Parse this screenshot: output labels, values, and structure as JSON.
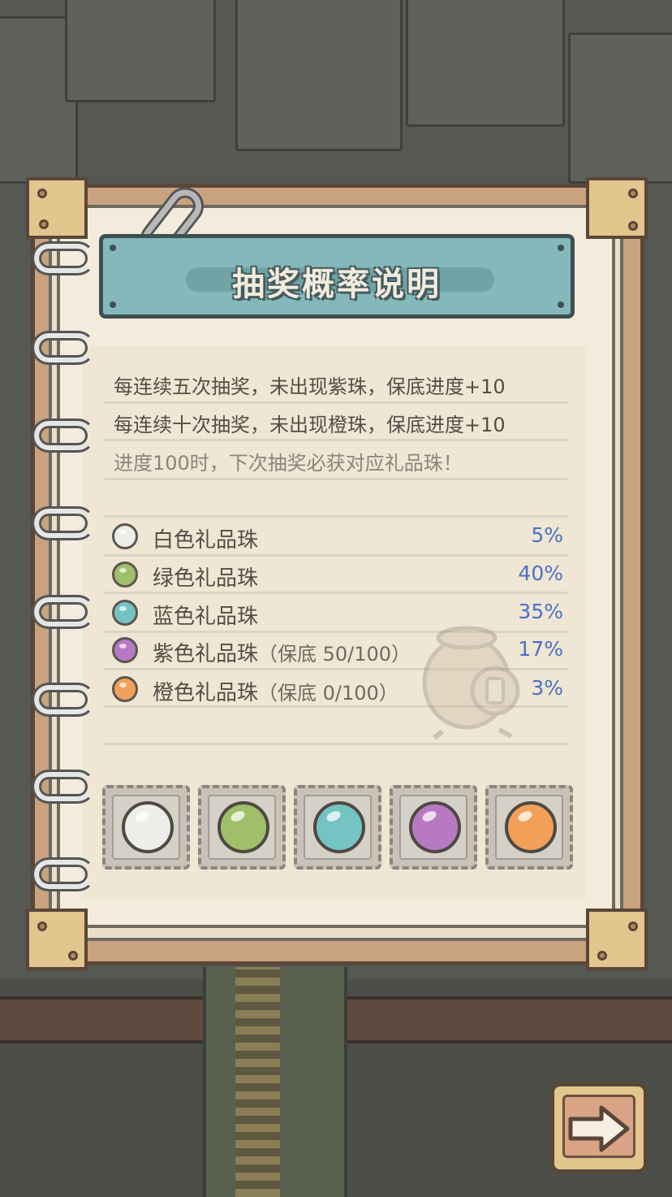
{
  "dialog": {
    "title": "抽奖概率说明"
  },
  "rules": {
    "line1": "每连续五次抽奖，未出现紫珠，保底进度+10",
    "line2": "每连续十次抽奖，未出现橙珠，保底进度+10",
    "line3": "进度100时，下次抽奖必获对应礼品珠！"
  },
  "beads": [
    {
      "name": "白色礼品珠",
      "guarantee": "",
      "rate": "5%",
      "color": "#ededea"
    },
    {
      "name": "绿色礼品珠",
      "guarantee": "",
      "rate": "40%",
      "color": "#9fbf6a"
    },
    {
      "name": "蓝色礼品珠",
      "guarantee": "",
      "rate": "35%",
      "color": "#74c4c4"
    },
    {
      "name": "紫色礼品珠",
      "guarantee": "（保底  50/100）",
      "rate": "17%",
      "color": "#b77ac2"
    },
    {
      "name": "橙色礼品珠",
      "guarantee": "（保底  0/100）",
      "rate": "3%",
      "color": "#f0a058"
    }
  ],
  "colors": {
    "rate_text": "#4b70c8",
    "banner": "#84b8bb",
    "page": "#f3ebdc"
  },
  "icons": {
    "next": "arrow-right-icon",
    "clip": "paperclip-icon",
    "watermark": "gift-bag-icon"
  }
}
